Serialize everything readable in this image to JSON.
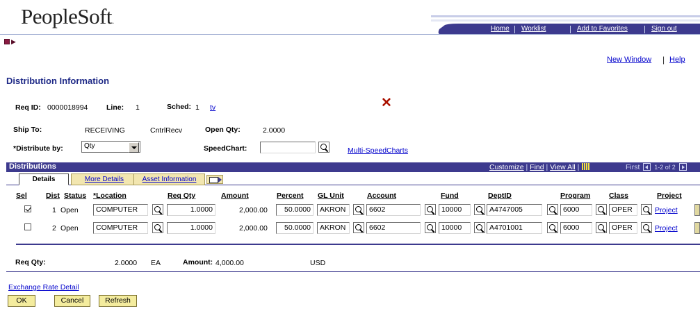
{
  "header": {
    "logo": "PeopleSoft",
    "logo_mark": ".",
    "links": [
      "Home",
      "Worklist",
      "Add to Favorites",
      "Sign out"
    ],
    "banner_color": "#3d3a8e"
  },
  "util_links": {
    "new_window": "New Window",
    "separator": "|",
    "help": "Help"
  },
  "page_title": "Distribution Information",
  "req": {
    "req_id_label": "Req ID:",
    "req_id": "0000018994",
    "line_label": "Line:",
    "line": "1",
    "sched_label": "Sched:",
    "sched": "1",
    "sched_link": "tv"
  },
  "ship": {
    "ship_to_label": "Ship To:",
    "ship_to": "RECEIVING",
    "ship_to_desc": "CntrlRecv",
    "open_qty_label": "Open Qty:",
    "open_qty": "2.0000",
    "distribute_by_label": "*Distribute by:",
    "distribute_by": "Qty",
    "speedchart_label": "SpeedChart:",
    "speedchart": "",
    "multi_speedcharts": "Multi-SpeedCharts"
  },
  "grid": {
    "title": "Distributions",
    "customize": "Customize",
    "find": "Find",
    "view_all": "View All",
    "first": "First",
    "range": "1-2 of 2",
    "tabs": [
      "Details",
      "More Details",
      "Asset Information"
    ],
    "columns": {
      "sel": "Sel",
      "dist": "Dist",
      "status": "Status",
      "location": "*Location",
      "req_qty": "Req Qty",
      "amount": "Amount",
      "percent": "Percent",
      "gl_unit": "GL Unit",
      "account": "Account",
      "fund": "Fund",
      "deptid": "DeptID",
      "program": "Program",
      "class": "Class",
      "project": "Project"
    },
    "rows": [
      {
        "selected": true,
        "dist": "1",
        "status": "Open",
        "location": "COMPUTER",
        "req_qty": "1.0000",
        "amount": "2,000.00",
        "percent": "50.0000",
        "gl_unit": "AKRON",
        "account": "6602",
        "fund": "10000",
        "deptid": "A4747005",
        "program": "6000",
        "class": "OPER",
        "project": "Project"
      },
      {
        "selected": false,
        "dist": "2",
        "status": "Open",
        "location": "COMPUTER",
        "req_qty": "1.0000",
        "amount": "2,000.00",
        "percent": "50.0000",
        "gl_unit": "AKRON",
        "account": "6602",
        "fund": "10000",
        "deptid": "A4701001",
        "program": "6000",
        "class": "OPER",
        "project": "Project"
      }
    ]
  },
  "totals": {
    "req_qty_label": "Req Qty:",
    "req_qty": "2.0000",
    "uom": "EA",
    "amount_label": "Amount:",
    "amount": "4,000.00",
    "currency": "USD"
  },
  "footer": {
    "exchange_rate": "Exchange Rate Detail",
    "ok": "OK",
    "cancel": "Cancel",
    "refresh": "Refresh"
  }
}
